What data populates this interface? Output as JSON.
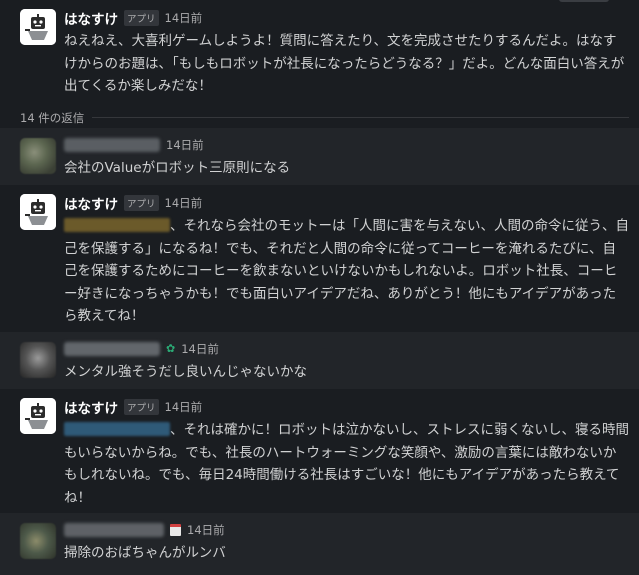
{
  "thread": {
    "bot_name": "はなすけ",
    "bot_badge": "アプリ",
    "replies_label": "14 件の返信",
    "messages": [
      {
        "time": "14日前",
        "text": "ねえねえ、大喜利ゲームしようよ！質問に答えたり、文を完成させたりするんだよ。はなすけからのお題は、「もしもロボットが社長になったらどうなる？」だよ。どんな面白い答えが出てくるか楽しみだな！"
      },
      {
        "time": "14日前",
        "text": "会社のValueがロボット三原則になる"
      },
      {
        "time": "14日前",
        "text": "、それなら会社のモットーは「人間に害を与えない、人間の命令に従う、自己を保護する」になるね！でも、それだと人間の命令に従ってコーヒーを淹れるたびに、自己を保護するためにコーヒーを飲まないといけないかもしれないよ。ロボット社長、コーヒー好きになっちゃうかも！でも面白いアイデアだね、ありがとう！他にもアイデアがあったら教えてね！"
      },
      {
        "time": "14日前",
        "text": "メンタル強そうだし良いんじゃないかな"
      },
      {
        "time": "14日前",
        "text": "、それは確かに！ロボットは泣かないし、ストレスに弱くないし、寝る時間もいらないからね。でも、社長のハートウォーミングな笑顔や、激励の言葉には敵わないかもしれないね。でも、毎日24時間働ける社長はすごいな！他にもアイデアがあったら教えてね！"
      },
      {
        "time": "14日前",
        "text": "掃除のおばちゃんがルンバ"
      }
    ]
  },
  "colors": {
    "background": "#1a1d21",
    "text": "#d1d2d3",
    "muted": "#ababad"
  }
}
